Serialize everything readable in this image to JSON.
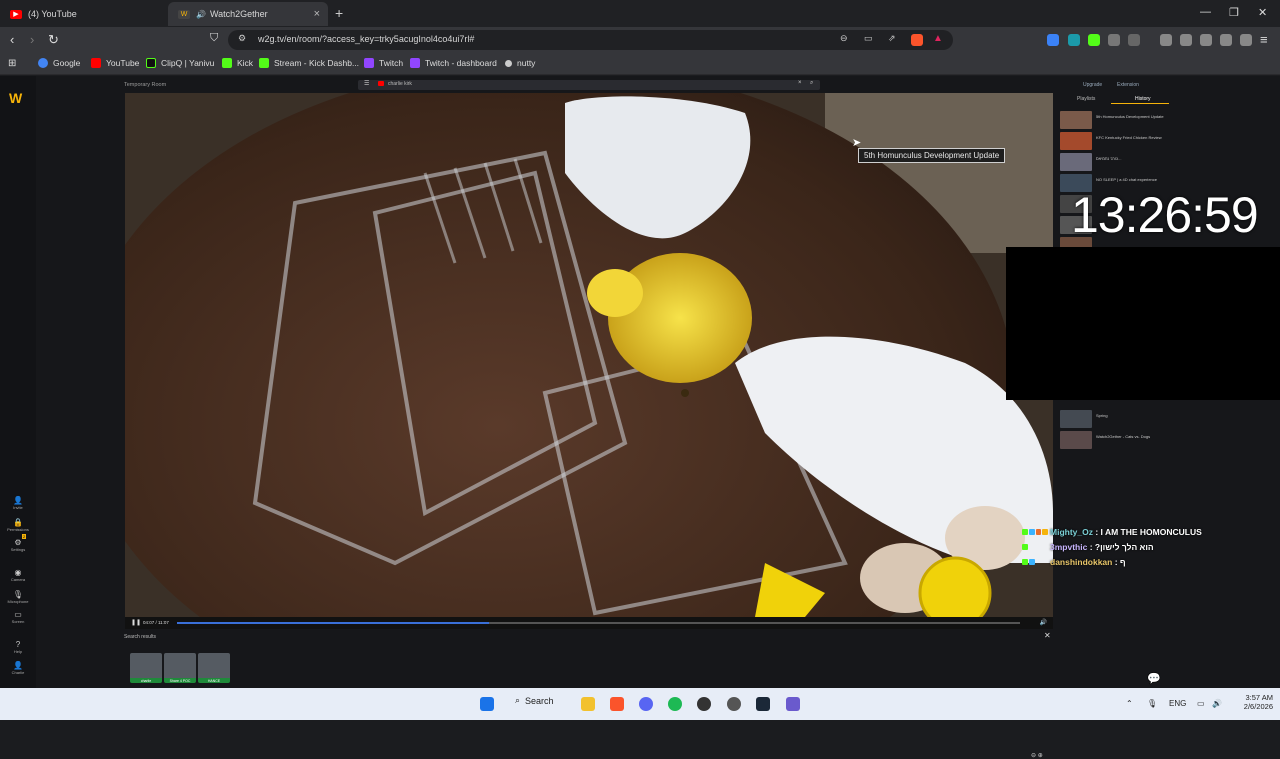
{
  "browser": {
    "tabs": [
      {
        "label": "(4) YouTube",
        "active": false
      },
      {
        "label": "Watch2Gether",
        "active": true
      }
    ],
    "url": "w2g.tv/en/room/?access_key=trky5acugInol4co4ui7rl#",
    "bookmarks": [
      {
        "label": "Google",
        "color": "#4285f4"
      },
      {
        "label": "YouTube",
        "color": "#ff0000"
      },
      {
        "label": "ClipQ | Yanivu",
        "color": "#222222"
      },
      {
        "label": "Kick",
        "color": "#53fc18"
      },
      {
        "label": "Stream - Kick Dashb...",
        "color": "#53fc18"
      },
      {
        "label": "Twitch",
        "color": "#9146ff"
      },
      {
        "label": "Twitch - dashboard",
        "color": "#9146ff"
      },
      {
        "label": "nutty",
        "color": "#cccccc"
      }
    ]
  },
  "app": {
    "logo": "W",
    "room_title": "Temporary Room",
    "search_query": "charlie kirk",
    "rail": [
      {
        "icon": "user-plus-icon",
        "glyph": "👤",
        "label": "Invite"
      },
      {
        "icon": "lock-icon",
        "glyph": "🔒",
        "label": "Permissions"
      },
      {
        "icon": "gear-icon",
        "glyph": "⚙",
        "label": "Settings"
      },
      {
        "icon": "camera-icon",
        "glyph": "◉",
        "label": "Camera"
      },
      {
        "icon": "microphone-icon",
        "glyph": "🎙",
        "label": "Microphone"
      },
      {
        "icon": "screen-icon",
        "glyph": "▭",
        "label": "Screen"
      },
      {
        "icon": "help-icon",
        "glyph": "?",
        "label": "Help"
      },
      {
        "icon": "profile-icon",
        "glyph": "👤",
        "label": "Charlie"
      }
    ],
    "settings_badge": "2",
    "video": {
      "tooltip": "5th Homunculus Development Update",
      "time": "04:07 / 11:07",
      "progress": 0.37
    },
    "search_results_label": "Search results",
    "results": [
      {
        "label": "charlie"
      },
      {
        "label": "Share 4 POC"
      },
      {
        "label": "HANCE"
      }
    ],
    "right_panel": {
      "upgrade": "Upgrade",
      "extension": "Extension",
      "tab_playlists": "Playlists",
      "tab_history": "History",
      "items": [
        {
          "title": "5th Homunculus Development Update",
          "color": "#7a5a4a"
        },
        {
          "title": "KFC Kentucky Fried Chicken Review",
          "color": "#a44a2c"
        },
        {
          "title": "ג'ורג' נחמיאס...",
          "color": "#6a6a7a"
        },
        {
          "title": "NO SLEEP | a 4D chat experience",
          "color": "#3b4a5a"
        },
        {
          "title": "",
          "color": "#444444"
        },
        {
          "title": "",
          "color": "#555555"
        },
        {
          "title": "",
          "color": "#6a4a3a"
        },
        {
          "title": "Spring",
          "color": "#444a52"
        },
        {
          "title": "Watch2Gether - Cats vs. Dogs",
          "color": "#5a4a4a"
        }
      ]
    }
  },
  "overlay": {
    "clock": "13:26:59",
    "chat": [
      {
        "user": "Mighty_Oz",
        "sep": " : ",
        "msg": "I AM THE HOMONCULUS",
        "color": "#7ad0d6"
      },
      {
        "user": "3mpvthic",
        "sep": " : ",
        "msg": "?הוא הלך לישון",
        "color": "#c9b6ff"
      },
      {
        "user": "danshindokkan",
        "sep": " : ",
        "msg": "ף",
        "color": "#e8c66a"
      }
    ]
  },
  "taskbar": {
    "search": "Search",
    "lang": "ENG",
    "time": "3:57 AM",
    "date": "2/6/2026"
  }
}
